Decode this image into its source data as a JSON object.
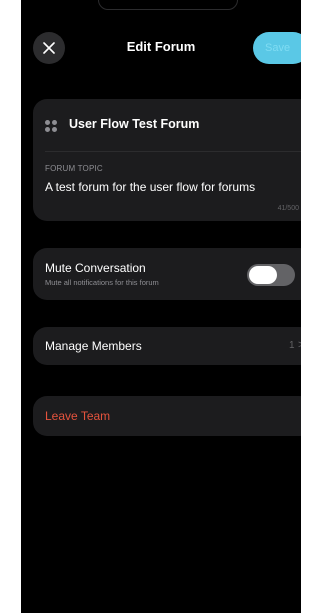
{
  "header": {
    "title": "Edit Forum",
    "save_label": "Save",
    "close_icon": "close-icon"
  },
  "forum": {
    "icon": "grid-dots-icon",
    "name": "User Flow Test Forum",
    "topic_label": "FORUM TOPIC",
    "topic_value": "A test forum for the user flow for forums",
    "char_count": "41/500"
  },
  "mute": {
    "title": "Mute Conversation",
    "subtitle": "Mute all notifications for this forum",
    "enabled": false
  },
  "members": {
    "label": "Manage Members",
    "count": "1",
    "chevron": ">"
  },
  "leave": {
    "label": "Leave Team",
    "color": "#e5533d"
  },
  "colors": {
    "background": "#000000",
    "card": "#1c1c1e",
    "accent": "#5ac8e6"
  }
}
